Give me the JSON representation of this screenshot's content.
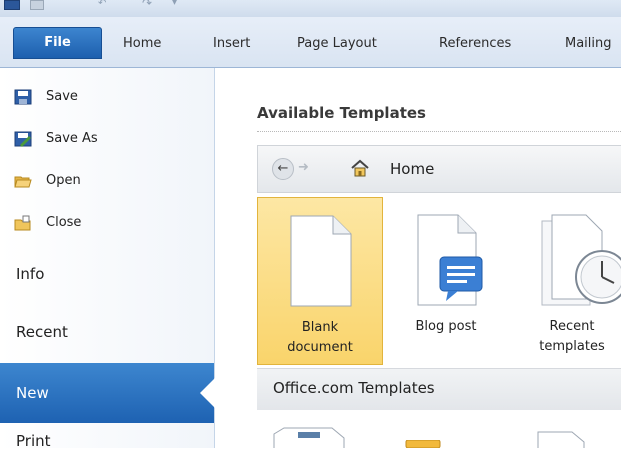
{
  "ribbon": {
    "tabs": {
      "file": "File",
      "home": "Home",
      "insert": "Insert",
      "page_layout": "Page Layout",
      "references": "References",
      "mailings": "Mailing"
    }
  },
  "backstage": {
    "commands": {
      "save": "Save",
      "save_as": "Save As",
      "open": "Open",
      "close": "Close"
    },
    "nav": {
      "info": "Info",
      "recent": "Recent",
      "new": "New",
      "print": "Print"
    }
  },
  "main": {
    "heading": "Available Templates",
    "breadcrumb": "Home",
    "templates": [
      {
        "line1": "Blank",
        "line2": "document"
      },
      {
        "line1": "Blog post",
        "line2": ""
      },
      {
        "line1": "Recent",
        "line2": "templates"
      }
    ],
    "section": "Office.com Templates"
  },
  "colors": {
    "accent": "#1e62b2",
    "selected_tile": "#f9d46b"
  }
}
